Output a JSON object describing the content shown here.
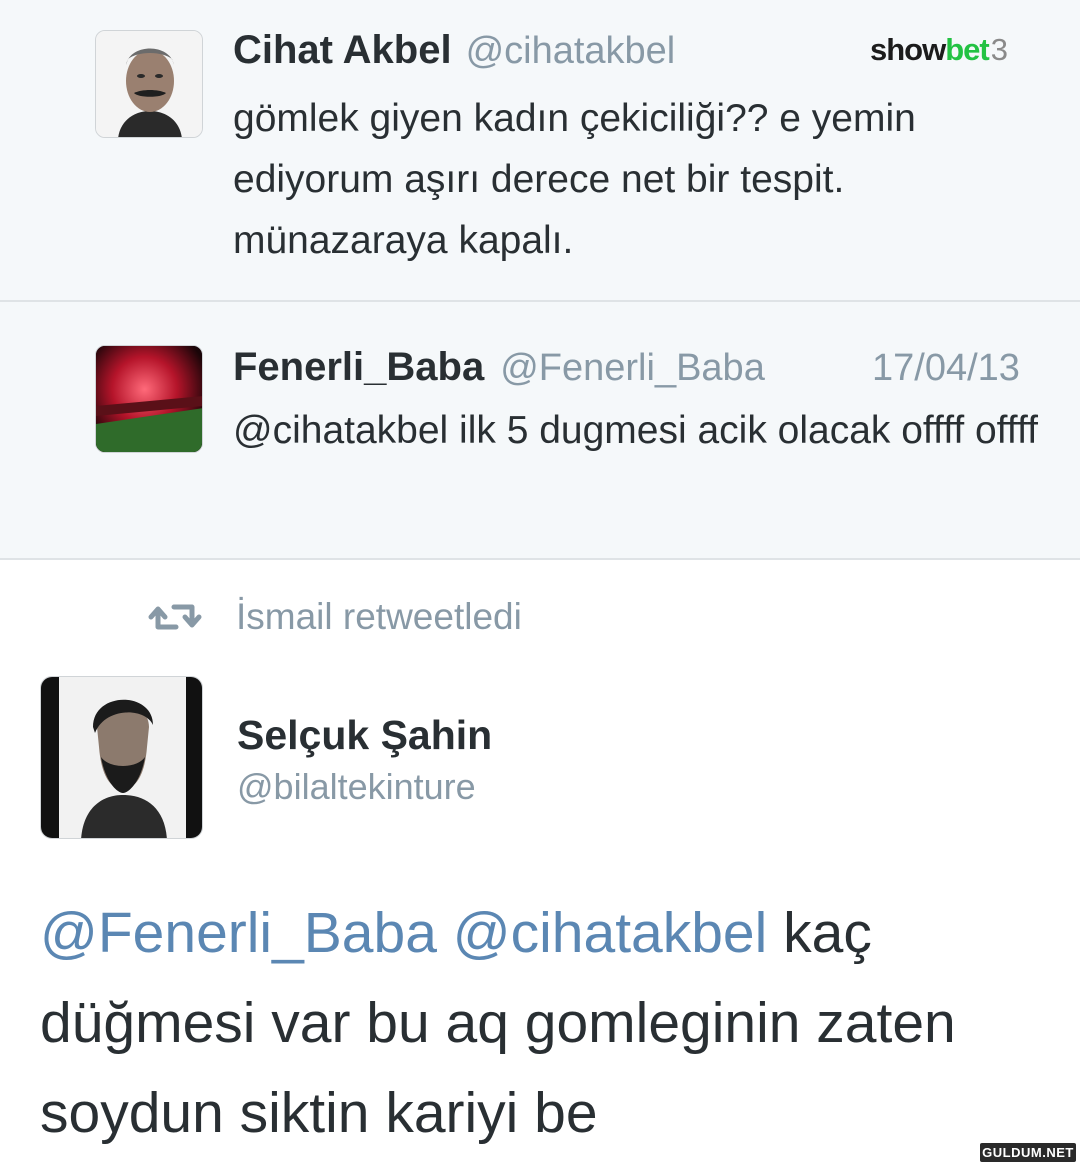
{
  "brand": {
    "show": "show",
    "bet": "bet",
    "num": "3"
  },
  "tweets": [
    {
      "name": "Cihat Akbel",
      "handle": "@cihatakbel",
      "text": "gömlek giyen kadın çekiciliği?? e yemin ediyorum aşırı derece net bir tespit. münazaraya kapalı."
    },
    {
      "name": "Fenerli_Baba",
      "handle": "@Fenerli_Baba",
      "date": "17/04/13",
      "text": "@cihatakbel ilk 5 dugmesi acik olacak offff offff"
    }
  ],
  "retweet": {
    "icon": "retweet-icon",
    "label": "İsmail retweetledi"
  },
  "featured": {
    "name": "Selçuk Şahin",
    "handle": "@bilaltekinture",
    "mention1": "@Fenerli_Baba",
    "mention2": "@cihatakbel",
    "text": " kaç düğmesi var bu aq gomleginin zaten soydun siktin kariyi be"
  },
  "watermark": "GULDUM.NET",
  "colors": {
    "mention": "#5b87b3",
    "secondary": "#8899a6",
    "brand_green": "#23c243",
    "card_bg": "#f5f8fa"
  }
}
